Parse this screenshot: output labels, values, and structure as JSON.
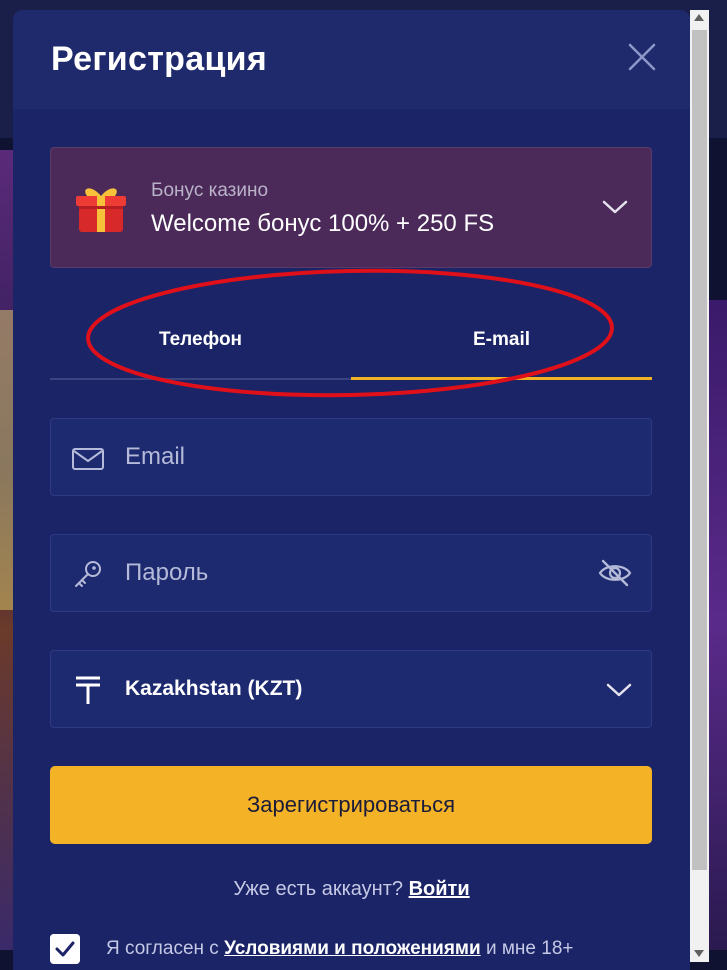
{
  "modal": {
    "title": "Регистрация"
  },
  "bonus": {
    "label": "Бонус казино",
    "value": "Welcome бонус 100% + 250 FS"
  },
  "tabs": [
    {
      "label": "Телефон",
      "active": false
    },
    {
      "label": "E-mail",
      "active": true
    }
  ],
  "form": {
    "email_placeholder": "Email",
    "password_placeholder": "Пароль",
    "currency": "Kazakhstan (KZT)",
    "register_label": "Зарегистрироваться"
  },
  "login": {
    "prompt": "Уже есть аккаунт?",
    "link": "Войти"
  },
  "terms": {
    "prefix": "Я согласен с",
    "link": "Условиями и положениями",
    "suffix": "и мне 18+",
    "checked": true
  },
  "colors": {
    "modal_bg": "#1a2466",
    "accent": "#f4b326",
    "annotation": "#e0101a"
  }
}
